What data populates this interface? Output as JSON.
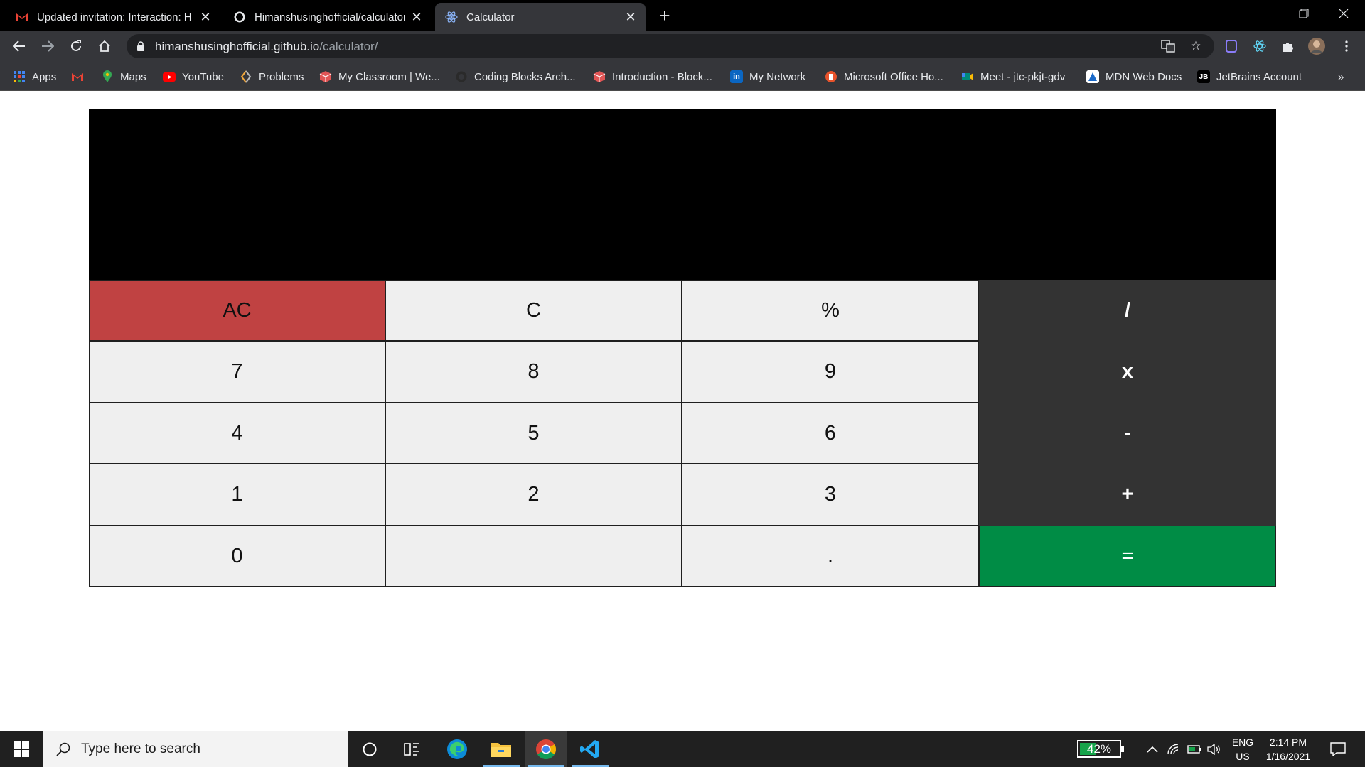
{
  "browser": {
    "tabs": [
      {
        "title": "Updated invitation: Interaction: H",
        "icon": "gmail-icon",
        "active": false
      },
      {
        "title": "Himanshusinghofficial/calculator",
        "icon": "github-icon",
        "active": false
      },
      {
        "title": "Calculator",
        "icon": "react-icon",
        "active": true
      }
    ],
    "new_tab_label": "+",
    "url_host": "himanshusinghofficial.github.io",
    "url_path": "/calculator/",
    "bookmarks": [
      {
        "label": "Apps",
        "icon": "apps-grid-icon",
        "color": "#4285f4"
      },
      {
        "label": "",
        "icon": "gmail-icon",
        "color": "#ea4335"
      },
      {
        "label": "Maps",
        "icon": "maps-pin-icon",
        "color": "#34a853"
      },
      {
        "label": "YouTube",
        "icon": "youtube-icon",
        "color": "#ff0000"
      },
      {
        "label": "Problems",
        "icon": "problems-icon",
        "color": "#f4a93b"
      },
      {
        "label": "My Classroom | We...",
        "icon": "classroom-icon",
        "color": "#e05555"
      },
      {
        "label": "Coding Blocks Arch...",
        "icon": "github-icon",
        "color": "#2a2a2a"
      },
      {
        "label": "Introduction - Block...",
        "icon": "blocks-icon",
        "color": "#e05555"
      },
      {
        "label": "My Network",
        "icon": "linkedin-icon",
        "color": "#0a66c2"
      },
      {
        "label": "Microsoft Office Ho...",
        "icon": "office-icon",
        "color": "#e8532b"
      },
      {
        "label": "Meet - jtc-pkjt-gdv",
        "icon": "meet-icon",
        "color": "#00897b"
      },
      {
        "label": "MDN Web Docs",
        "icon": "mdn-icon",
        "color": "#83d0f2"
      },
      {
        "label": "JetBrains Account",
        "icon": "jetbrains-icon",
        "color": "#000000"
      }
    ],
    "bookmarks_overflow": "»"
  },
  "calculator": {
    "display_value": "",
    "keys": [
      {
        "label": "AC",
        "kind": "clear"
      },
      {
        "label": "C",
        "kind": "fn"
      },
      {
        "label": "%",
        "kind": "fn"
      },
      {
        "label": "/",
        "kind": "op"
      },
      {
        "label": "7",
        "kind": "num"
      },
      {
        "label": "8",
        "kind": "num"
      },
      {
        "label": "9",
        "kind": "num"
      },
      {
        "label": "x",
        "kind": "op"
      },
      {
        "label": "4",
        "kind": "num"
      },
      {
        "label": "5",
        "kind": "num"
      },
      {
        "label": "6",
        "kind": "num"
      },
      {
        "label": "-",
        "kind": "op"
      },
      {
        "label": "1",
        "kind": "num"
      },
      {
        "label": "2",
        "kind": "num"
      },
      {
        "label": "3",
        "kind": "num"
      },
      {
        "label": "+",
        "kind": "op"
      },
      {
        "label": "0",
        "kind": "num"
      },
      {
        "label": "",
        "kind": "num"
      },
      {
        "label": ".",
        "kind": "num"
      },
      {
        "label": "=",
        "kind": "equal"
      }
    ],
    "colors": {
      "clear": "#c04242",
      "operator": "#333333",
      "equal": "#008c45",
      "key": "#efefef"
    }
  },
  "taskbar": {
    "search_placeholder": "Type here to search",
    "battery_percent": "42%",
    "battery_level": 0.42,
    "language_top": "ENG",
    "language_bottom": "US",
    "time": "2:14 PM",
    "date": "1/16/2021"
  }
}
